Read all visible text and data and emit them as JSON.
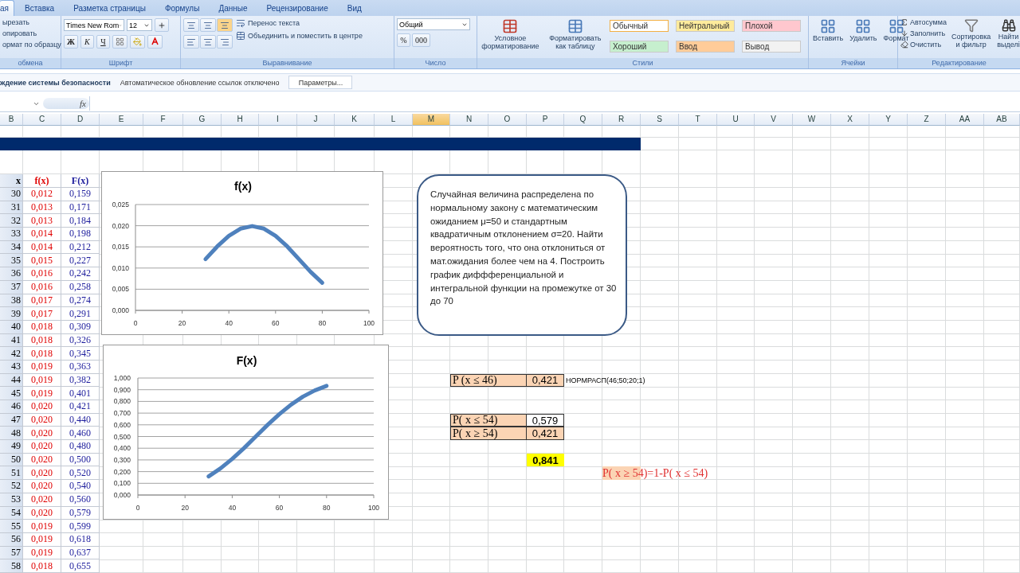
{
  "ribbon_tabs": [
    {
      "label": "ая",
      "selected": true
    },
    {
      "label": "Вставка",
      "selected": false
    },
    {
      "label": "Разметка страницы",
      "selected": false
    },
    {
      "label": "Формулы",
      "selected": false
    },
    {
      "label": "Данные",
      "selected": false
    },
    {
      "label": "Рецензирование",
      "selected": false
    },
    {
      "label": "Вид",
      "selected": false
    }
  ],
  "clipboard": {
    "items": [
      "ырезать",
      "опировать",
      "ормат по образцу"
    ],
    "group": "обмена"
  },
  "font": {
    "name": "Times New Rom",
    "size": "12",
    "bold": "Ж",
    "italic": "К",
    "underline": "Ч",
    "group": "Шрифт"
  },
  "alignment": {
    "wrap": "Перенос текста",
    "merge": "Объединить и поместить в центре",
    "group": "Выравнивание"
  },
  "number": {
    "format": "Общий",
    "percent": "%",
    "thousands": "000",
    "group": "Число"
  },
  "styles": {
    "conditional": "Условное форматирование",
    "as_table": "Форматировать как таблицу",
    "group": "Стили",
    "cell_styles": [
      {
        "label": "Обычный",
        "color": "#ffffff"
      },
      {
        "label": "Нейтральный",
        "color": "#ffeb9c"
      },
      {
        "label": "Плохой",
        "color": "#ffc7ce"
      },
      {
        "label": "Хороший",
        "color": "#c6efce"
      },
      {
        "label": "Ввод",
        "color": "#ffcc99"
      },
      {
        "label": "Вывод",
        "color": "#f2f2f2"
      }
    ]
  },
  "cells": {
    "buttons": [
      "Вставить",
      "Удалить",
      "Формат"
    ],
    "group": "Ячейки"
  },
  "editing": {
    "items": [
      "Автосумма",
      "Заполнить",
      "Очистить"
    ],
    "sort": "Сортировка и фильтр",
    "find": [
      "Найти",
      "выделі"
    ],
    "group": "Редактирование"
  },
  "message_bar": {
    "title": "ждение системы безопасности",
    "text": "Автоматическое обновление ссылок отключено",
    "button": "Параметры..."
  },
  "formula_bar": {
    "fx": "fx"
  },
  "columns": [
    {
      "label": "B",
      "selected": false
    },
    {
      "label": "C",
      "selected": false
    },
    {
      "label": "D",
      "selected": false
    },
    {
      "label": "E",
      "selected": false
    },
    {
      "label": "F",
      "selected": false
    },
    {
      "label": "G",
      "selected": false
    },
    {
      "label": "H",
      "selected": false
    },
    {
      "label": "I",
      "selected": false
    },
    {
      "label": "J",
      "selected": false
    },
    {
      "label": "K",
      "selected": false
    },
    {
      "label": "L",
      "selected": false
    },
    {
      "label": "M",
      "selected": true
    },
    {
      "label": "N",
      "selected": false
    },
    {
      "label": "O",
      "selected": false
    },
    {
      "label": "P",
      "selected": false
    },
    {
      "label": "Q",
      "selected": false
    },
    {
      "label": "R",
      "selected": false
    },
    {
      "label": "S",
      "selected": false
    },
    {
      "label": "T",
      "selected": false
    },
    {
      "label": "U",
      "selected": false
    },
    {
      "label": "V",
      "selected": false
    },
    {
      "label": "W",
      "selected": false
    },
    {
      "label": "X",
      "selected": false
    },
    {
      "label": "Y",
      "selected": false
    },
    {
      "label": "Z",
      "selected": false
    },
    {
      "label": "AA",
      "selected": false
    },
    {
      "label": "AB",
      "selected": false
    }
  ],
  "table": {
    "headers": [
      "x",
      "f(x)",
      "F(x)"
    ],
    "rows": [
      [
        "30",
        "0,012",
        "0,159"
      ],
      [
        "31",
        "0,013",
        "0,171"
      ],
      [
        "32",
        "0,013",
        "0,184"
      ],
      [
        "33",
        "0,014",
        "0,198"
      ],
      [
        "34",
        "0,014",
        "0,212"
      ],
      [
        "35",
        "0,015",
        "0,227"
      ],
      [
        "36",
        "0,016",
        "0,242"
      ],
      [
        "37",
        "0,016",
        "0,258"
      ],
      [
        "38",
        "0,017",
        "0,274"
      ],
      [
        "39",
        "0,017",
        "0,291"
      ],
      [
        "40",
        "0,018",
        "0,309"
      ],
      [
        "41",
        "0,018",
        "0,326"
      ],
      [
        "42",
        "0,018",
        "0,345"
      ],
      [
        "43",
        "0,019",
        "0,363"
      ],
      [
        "44",
        "0,019",
        "0,382"
      ],
      [
        "45",
        "0,019",
        "0,401"
      ],
      [
        "46",
        "0,020",
        "0,421"
      ],
      [
        "47",
        "0,020",
        "0,440"
      ],
      [
        "48",
        "0,020",
        "0,460"
      ],
      [
        "49",
        "0,020",
        "0,480"
      ],
      [
        "50",
        "0,020",
        "0,500"
      ],
      [
        "51",
        "0,020",
        "0,520"
      ],
      [
        "52",
        "0,020",
        "0,540"
      ],
      [
        "53",
        "0,020",
        "0,560"
      ],
      [
        "54",
        "0,020",
        "0,579"
      ],
      [
        "55",
        "0,019",
        "0,599"
      ],
      [
        "56",
        "0,019",
        "0,618"
      ],
      [
        "57",
        "0,019",
        "0,637"
      ],
      [
        "58",
        "0,018",
        "0,655"
      ]
    ]
  },
  "charts": [
    {
      "chart_data": {
        "type": "line",
        "title": "f(x)",
        "x": [
          30,
          35,
          40,
          45,
          50,
          55,
          60,
          65,
          70,
          75,
          80
        ],
        "grid": true,
        "series": [
          {
            "color": "#4f81bd",
            "values": [
              0.0121,
              0.0151,
              0.0176,
              0.0193,
              0.0199,
              0.0193,
              0.0176,
              0.0151,
              0.0121,
              0.0091,
              0.0065
            ]
          }
        ],
        "xlim": [
          0,
          100
        ],
        "ylim": [
          0,
          0.025
        ],
        "xticks": [
          0,
          20,
          40,
          60,
          80,
          100
        ],
        "yticks": [
          {
            "value": 0,
            "label": "0,000"
          },
          {
            "value": 0.005,
            "label": "0,005"
          },
          {
            "value": 0.01,
            "label": "0,010"
          },
          {
            "value": 0.015,
            "label": "0,015"
          },
          {
            "value": 0.02,
            "label": "0,020"
          },
          {
            "value": 0.025,
            "label": "0,025"
          }
        ]
      }
    },
    {
      "chart_data": {
        "type": "line",
        "title": "F(x)",
        "x": [
          30,
          35,
          40,
          45,
          50,
          55,
          60,
          65,
          70,
          75,
          80
        ],
        "grid": true,
        "series": [
          {
            "color": "#4f81bd",
            "values": [
              0.159,
              0.227,
              0.309,
              0.401,
              0.5,
              0.599,
              0.691,
              0.773,
              0.841,
              0.894,
              0.933
            ]
          }
        ],
        "xlim": [
          0,
          100
        ],
        "ylim": [
          0,
          1
        ],
        "xticks": [
          0,
          20,
          40,
          60,
          80,
          100
        ],
        "yticks": [
          {
            "value": 0,
            "label": "0,000"
          },
          {
            "value": 0.1,
            "label": "0,100"
          },
          {
            "value": 0.2,
            "label": "0,200"
          },
          {
            "value": 0.3,
            "label": "0,300"
          },
          {
            "value": 0.4,
            "label": "0,400"
          },
          {
            "value": 0.5,
            "label": "0,500"
          },
          {
            "value": 0.6,
            "label": "0,600"
          },
          {
            "value": 0.7,
            "label": "0,700"
          },
          {
            "value": 0.8,
            "label": "0,800"
          },
          {
            "value": 0.9,
            "label": "0,900"
          },
          {
            "value": 1,
            "label": "1,000"
          }
        ]
      }
    }
  ],
  "task_text": "Случайная величина распределена по нормальному закону с математическим ожиданием μ=50 и стандартным квадратичным отклонением σ=20.  Найти вероятность того, что она отклониться от мат.ожидания более чем на 4. Построить график диффференциальной и интегральной функции на промежутке от 30 до 70",
  "probabilities": [
    {
      "label": "P (x ≤ 46)",
      "value": "0,421",
      "highlighted": true,
      "note": "НОРМРАСП(46;50;20;1)"
    },
    {
      "label": "P( x ≤ 54)",
      "value": "0,579",
      "highlighted": false
    },
    {
      "label": "P( x ≥ 54)",
      "value": "0,421",
      "highlighted": true
    }
  ],
  "result": "0,841",
  "formula": "P( x ≥ 54)=1-P( x ≤ 54)"
}
